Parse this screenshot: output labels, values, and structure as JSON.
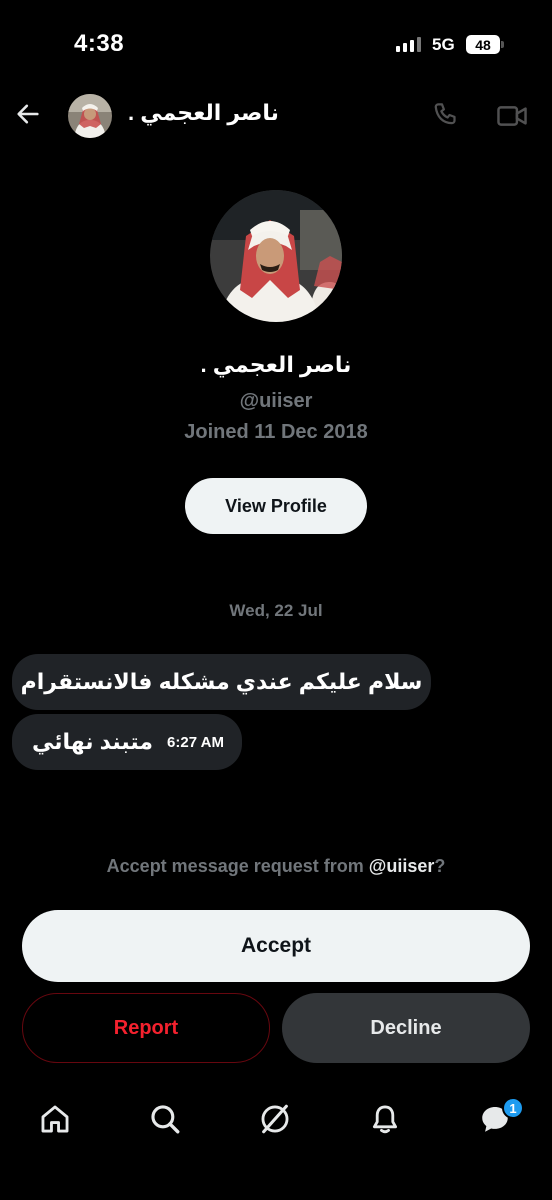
{
  "status_bar": {
    "time": "4:38",
    "network": "5G",
    "battery": "48"
  },
  "header": {
    "name": "ناصر العجمي ."
  },
  "profile": {
    "name": "ناصر العجمي .",
    "handle": "@uiiser",
    "joined": "Joined 11 Dec 2018",
    "view_profile_label": "View Profile"
  },
  "conversation": {
    "date": "Wed, 22 Jul",
    "messages": [
      {
        "text": "سلام عليكم عندي مشكله فالانستقرام",
        "time": ""
      },
      {
        "text": "متبند نهائي",
        "time": "6:27 AM"
      }
    ]
  },
  "request": {
    "prefix": "Accept message request from ",
    "handle": "@uiiser",
    "suffix": "?",
    "accept_label": "Accept",
    "report_label": "Report",
    "decline_label": "Decline"
  },
  "nav": {
    "items": [
      "home-icon",
      "search-icon",
      "grok-icon",
      "notifications-icon",
      "messages-icon"
    ],
    "messages_badge": "1"
  },
  "colors": {
    "background": "#000000",
    "muted_text": "#71767b",
    "report_red": "#f4212e",
    "badge_blue": "#1d9bf0",
    "bubble": "#202327"
  }
}
